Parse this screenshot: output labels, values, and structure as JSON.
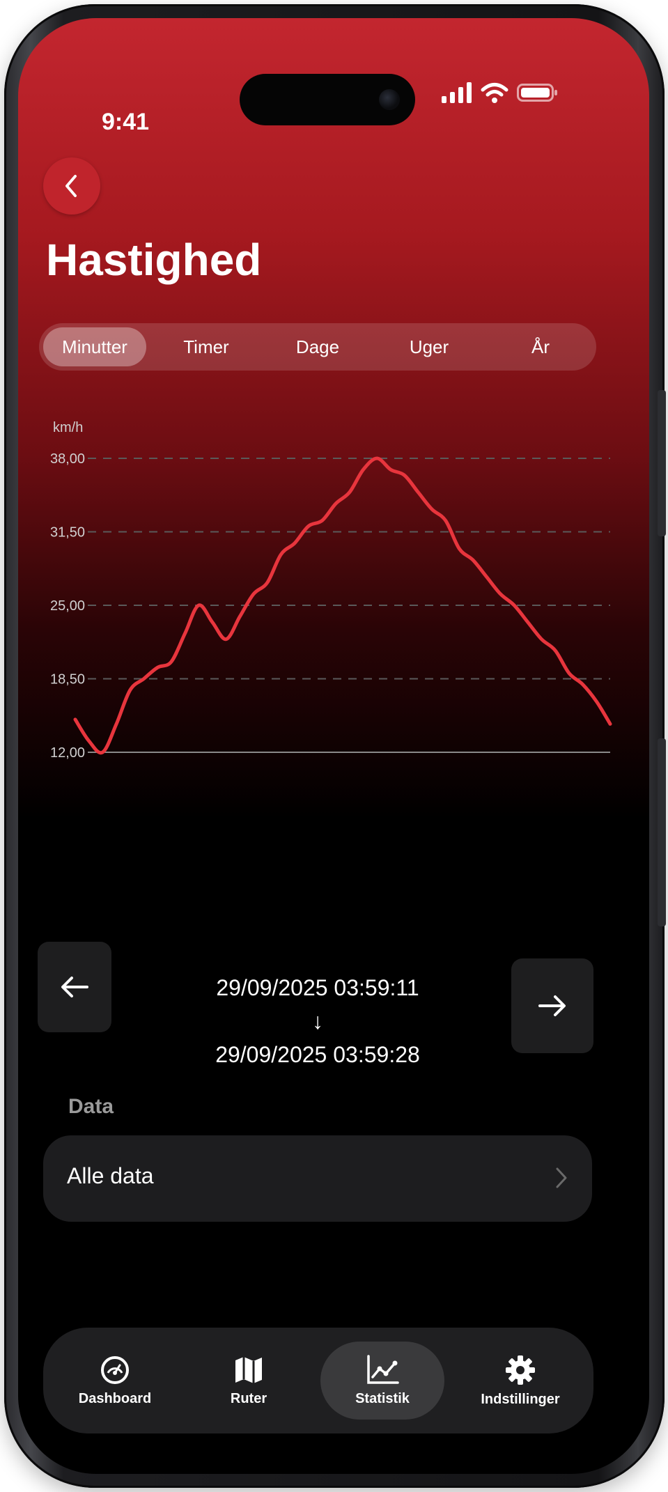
{
  "status_bar": {
    "time": "9:41",
    "icons": [
      "signal-icon",
      "wifi-icon",
      "battery-icon"
    ]
  },
  "header": {
    "back_icon": "chevron-left-icon",
    "title": "Hastighed"
  },
  "range_tabs": [
    {
      "label": "Minutter",
      "active": true
    },
    {
      "label": "Timer",
      "active": false
    },
    {
      "label": "Dage",
      "active": false
    },
    {
      "label": "Uger",
      "active": false
    },
    {
      "label": "År",
      "active": false
    }
  ],
  "chart_data": {
    "type": "line",
    "ylabel": "km/h",
    "ylim": [
      12.0,
      38.0
    ],
    "yticks": [
      "38,00",
      "31,50",
      "25,00",
      "18,50",
      "12,00"
    ],
    "grid": "dashed horizontal",
    "series": [
      {
        "color": "#e8353d",
        "values": [
          14.9,
          13.0,
          12.0,
          14.5,
          17.5,
          18.5,
          19.5,
          20.0,
          22.5,
          25.0,
          23.5,
          22.0,
          24.0,
          26.0,
          27.0,
          29.5,
          30.5,
          32.0,
          32.5,
          34.0,
          35.0,
          37.0,
          38.0,
          37.0,
          36.5,
          35.0,
          33.5,
          32.5,
          30.0,
          29.0,
          27.5,
          26.0,
          25.0,
          23.5,
          22.0,
          21.0,
          19.0,
          18.0,
          16.5,
          14.5
        ]
      }
    ]
  },
  "date_range": {
    "prev_icon": "arrow-left-icon",
    "next_icon": "arrow-right-icon",
    "start": "29/09/2025 03:59:11",
    "separator": "↓",
    "end": "29/09/2025 03:59:28"
  },
  "data_section": {
    "label": "Data",
    "row_label": "Alle data",
    "row_icon": "chevron-right-icon"
  },
  "tab_bar": [
    {
      "label": "Dashboard",
      "icon": "gauge-icon",
      "active": false
    },
    {
      "label": "Ruter",
      "icon": "map-icon",
      "active": false
    },
    {
      "label": "Statistik",
      "icon": "chart-line-icon",
      "active": true
    },
    {
      "label": "Indstillinger",
      "icon": "gear-icon",
      "active": false
    }
  ],
  "colors": {
    "accent": "#c0242c",
    "line": "#e8353d",
    "background": "#000000"
  }
}
